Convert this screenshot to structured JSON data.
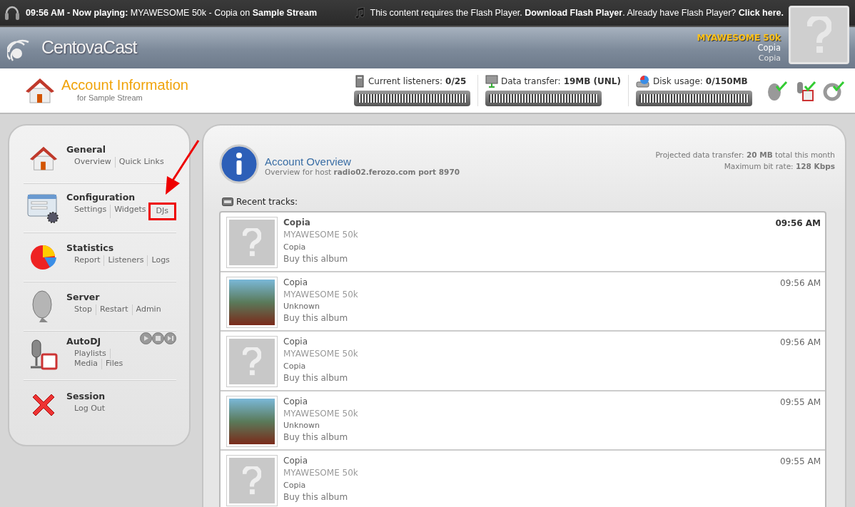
{
  "now_playing": {
    "text": "**09:56 AM - Now playing:** MYAWESOME 50k - Copia on **Sample Stream**"
  },
  "flash_notice": {
    "text_before": "This content requires the Flash Player.",
    "download_link": "Download Flash Player",
    "text_middle": ". Already have Flash Player?",
    "click_link": "Click here."
  },
  "logo": {
    "text": "CentovaCast"
  },
  "current_track": {
    "title": "MYAWESOME 50k",
    "artist": "Copia",
    "album": "Copia"
  },
  "page_header": {
    "title": "Account Information",
    "subtitle": "for Sample Stream"
  },
  "meters": [
    {
      "label": "Current listeners:",
      "value": "0/25",
      "level": 0,
      "kind": "listeners"
    },
    {
      "label": "Data transfer:",
      "value": "19MB (UNL)",
      "level": 0,
      "kind": "transfer"
    },
    {
      "label": "Disk usage:",
      "value": "0/150MB",
      "level": 0,
      "kind": "disk"
    }
  ],
  "sidebar": {
    "sections": [
      {
        "title": "General",
        "kind": "house",
        "links": [
          {
            "label": "Overview",
            "highlighted": false
          },
          {
            "label": "Quick Links",
            "highlighted": false
          }
        ]
      },
      {
        "title": "Configuration",
        "kind": "config",
        "links": [
          {
            "label": "Settings",
            "highlighted": false
          },
          {
            "label": "Widgets",
            "highlighted": false
          },
          {
            "label": "DJs",
            "highlighted": true
          }
        ]
      },
      {
        "title": "Statistics",
        "kind": "pie",
        "links": [
          {
            "label": "Report",
            "highlighted": false
          },
          {
            "label": "Listeners",
            "highlighted": false
          },
          {
            "label": "Logs",
            "highlighted": false
          }
        ]
      },
      {
        "title": "Server",
        "kind": "dish",
        "links": [
          {
            "label": "Stop",
            "highlighted": false
          },
          {
            "label": "Restart",
            "highlighted": false
          },
          {
            "label": "Admin",
            "highlighted": false
          }
        ]
      },
      {
        "title": "AutoDJ",
        "kind": "mic",
        "links": [
          {
            "label": "Playlists",
            "highlighted": false
          },
          {
            "label": "Media",
            "highlighted": false
          },
          {
            "label": "Files",
            "highlighted": false
          }
        ]
      },
      {
        "title": "Session",
        "kind": "cross",
        "links": [
          {
            "label": "Log Out",
            "highlighted": false
          }
        ]
      }
    ]
  },
  "overview": {
    "title": "Account Overview",
    "subtitle": "Overview for host **radio02.ferozo.com port 8970**",
    "projected": "Projected data transfer:  **20 MB** total this month",
    "bitrate": "Maximum bit rate: **128 Kbps**"
  },
  "recent_tracks": {
    "heading": "Recent tracks:",
    "tracks": [
      {
        "title": "Copia",
        "artist": "MYAWESOME 50k",
        "album": "Copia",
        "buy": "Buy this album",
        "time": "09:56 AM",
        "kind": "none",
        "current": true
      },
      {
        "title": "Copia",
        "artist": "MYAWESOME 50k",
        "album": "Unknown",
        "buy": "Buy this album",
        "time": "09:56 AM",
        "kind": "photo",
        "current": false
      },
      {
        "title": "Copia",
        "artist": "MYAWESOME 50k",
        "album": "Copia",
        "buy": "Buy this album",
        "time": "09:56 AM",
        "kind": "none",
        "current": false
      },
      {
        "title": "Copia",
        "artist": "MYAWESOME 50k",
        "album": "Unknown",
        "buy": "Buy this album",
        "time": "09:55 AM",
        "kind": "photo",
        "current": false
      },
      {
        "title": "Copia",
        "artist": "MYAWESOME 50k",
        "album": "Copia",
        "buy": "Buy this album",
        "time": "09:55 AM",
        "kind": "none",
        "current": false
      }
    ]
  }
}
